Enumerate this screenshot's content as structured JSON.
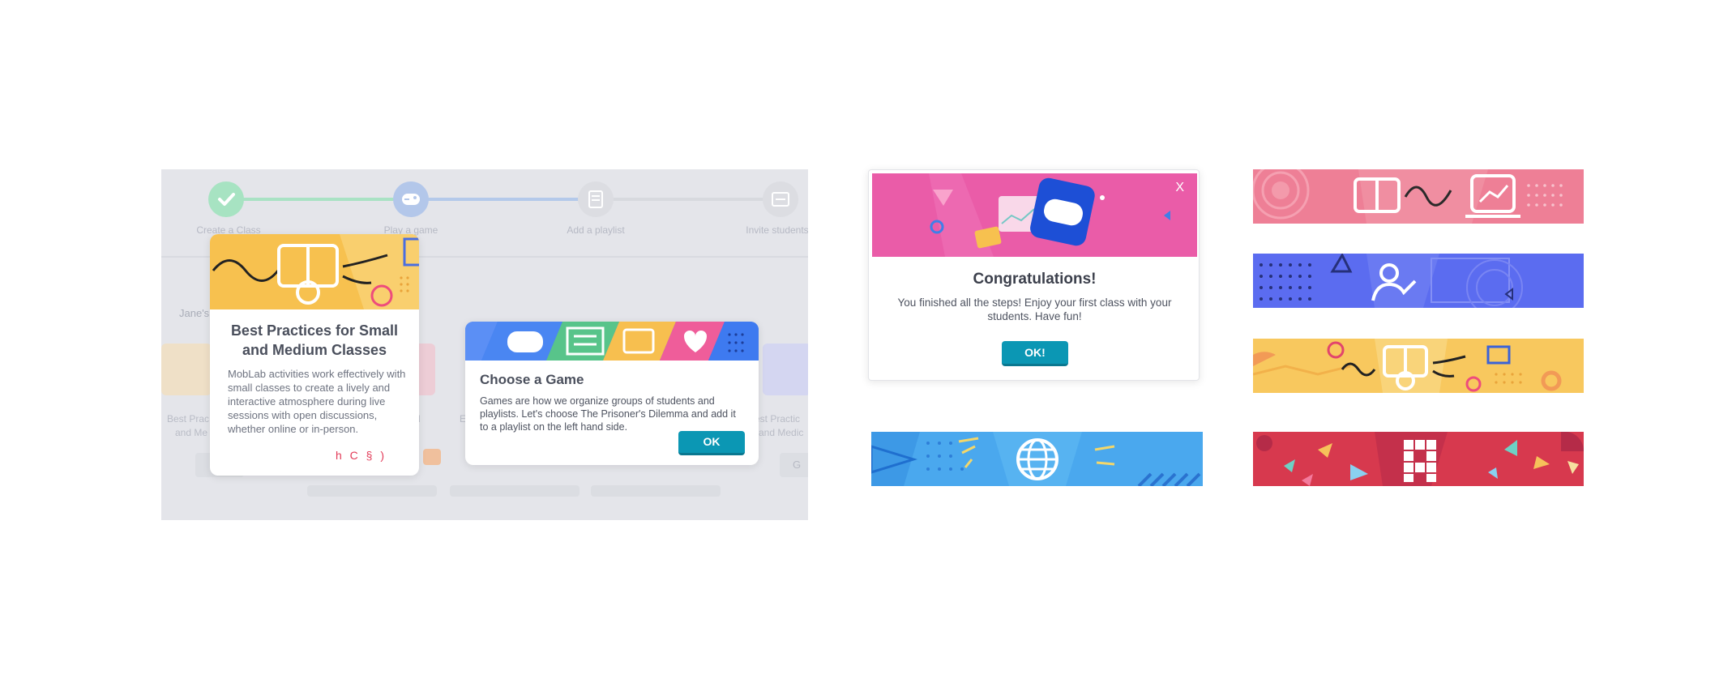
{
  "stepper": {
    "steps": [
      {
        "label": "Create a Class",
        "status": "done"
      },
      {
        "label": "Play a game",
        "status": "current"
      },
      {
        "label": "Add a playlist",
        "status": "todo"
      },
      {
        "label": "Invite students",
        "status": "todo"
      }
    ]
  },
  "background_page": {
    "section_label": "Jane's",
    "tile_texts": [
      "Best Prac",
      "and Me",
      "l",
      "E",
      "est Practic",
      "and Medic",
      "Best Pract",
      "and Me"
    ],
    "partial_button": "G"
  },
  "best_practices_card": {
    "title": "Best Practices for Small and Medium Classes",
    "body": "MobLab activities work effectively with small classes to create a lively and interactive atmosphere during live sessions with open discussions, whether online or in-person.",
    "glyphs": "h C § )"
  },
  "choose_game_card": {
    "title": "Choose a Game",
    "body": "Games are how we organize groups of students and playlists. Let's choose The Prisoner's Dilemma and add it to a playlist on the left hand side.",
    "ok_label": "OK"
  },
  "congrats_modal": {
    "title": "Congratulations!",
    "body": "You finished all the steps! Enjoy your first class with your students. Have fun!",
    "ok_label": "OK!",
    "close_label": "X"
  },
  "colors": {
    "teal_button": "#0b97b4",
    "pink_banner": "#ee7f96",
    "blue_banner": "#5b6cf0",
    "yellow_banner": "#f8c85e",
    "sky_banner": "#4aa8ee",
    "red_banner": "#d7394e",
    "congrats_header": "#ea5ca8"
  }
}
